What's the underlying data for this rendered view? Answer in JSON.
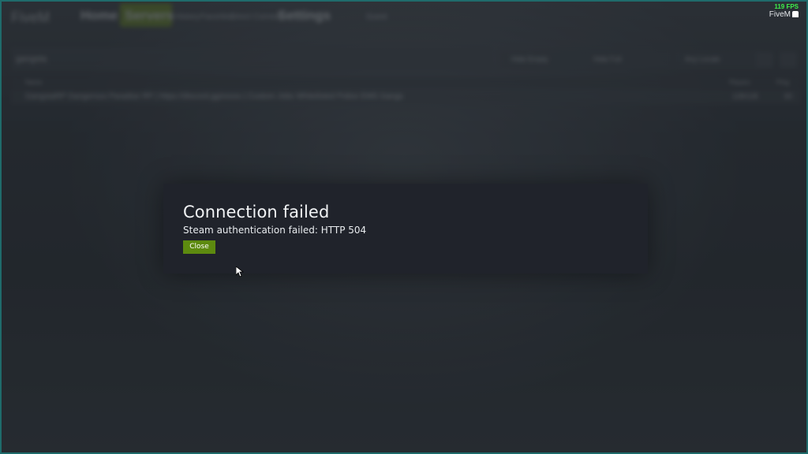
{
  "background_menu": {
    "logo": "FiveM",
    "nav": {
      "home": "Home",
      "servers": "Servers",
      "history": "History",
      "favorites": "Favorites",
      "direct_connect": "Direct Connect",
      "settings": "Settings",
      "user": "Guest"
    },
    "search": {
      "value": "gangsta"
    },
    "filters": {
      "hide_empty": "Hide Empty",
      "hide_full": "Hide Full",
      "any_locale": "Any Locale"
    },
    "list": {
      "columns": {
        "name": "Name",
        "players": "Players",
        "ping": "Ping"
      },
      "rows": [
        {
          "name": "GangstaRP Dangerous Paradise RP | https://discord.gg/xxxxx | Custom Jobs Whitelisted Police EMS Gangs",
          "players": "128/128",
          "ping": "60"
        }
      ]
    }
  },
  "overlay": {
    "fps": "119 FPS",
    "brand": "FiveM"
  },
  "dialog": {
    "title": "Connection failed",
    "message": "Steam authentication failed: HTTP 504",
    "close_label": "Close"
  },
  "colors": {
    "accent_green": "#5d8a0f",
    "modal_bg": "#20232b",
    "fps_green": "#3df04a"
  }
}
